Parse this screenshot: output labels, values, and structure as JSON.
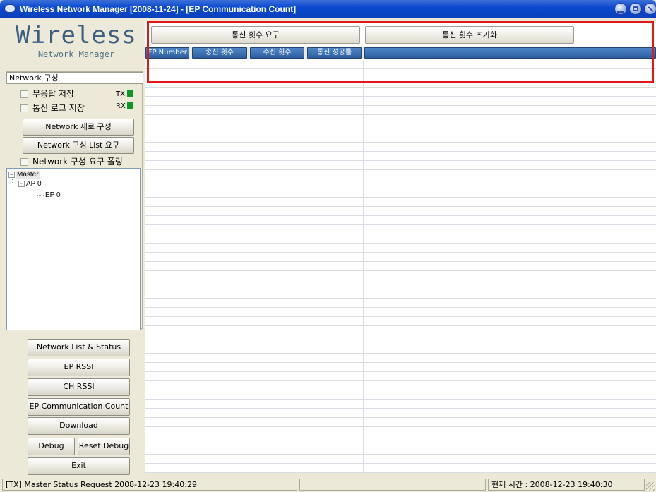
{
  "window": {
    "title": "Wireless Network Manager [2008-11-24] - [EP Communication Count]"
  },
  "logo": {
    "title": "Wireless",
    "subtitle": "Network Manager"
  },
  "network_group": {
    "title": "Network 구성",
    "checkbox_noresp_save": "무응답 저장",
    "checkbox_comm_log_save": "통신 로그 저장",
    "tx_label": "TX",
    "rx_label": "RX",
    "tx_color": "#0a9a22",
    "rx_color": "#0a9a22",
    "btn_new_config": "Network 새로 구성",
    "btn_config_list_request": "Network 구성 List 요구",
    "checkbox_config_polling": "Network 구성 요구 폴링"
  },
  "tree": {
    "root": "Master",
    "ap": "AP 0",
    "ep": "EP 0"
  },
  "nav_buttons": {
    "network_list_status": "Network List & Status",
    "ep_rssi": "EP RSSI",
    "ch_rssi": "CH RSSI",
    "ep_comm_count": "EP Communication Count",
    "download": "Download",
    "debug": "Debug",
    "reset_debug": "Reset Debug",
    "exit": "Exit"
  },
  "toolbar": {
    "request_count": "통신 횟수 요구",
    "reset_count": "통신 횟수 초기화"
  },
  "table": {
    "columns": [
      "EP Number",
      "송신 횟수",
      "수신 횟수",
      "통신 성공률",
      ""
    ]
  },
  "statusbar": {
    "message": "[TX] Master  Status Request 2008-12-23 19:40:29",
    "middle": "",
    "clock": "현재 시간 : 2008-12-23 19:40:30"
  },
  "colors": {
    "highlight": "#e01818",
    "header_blue": "#2d5f9f"
  }
}
